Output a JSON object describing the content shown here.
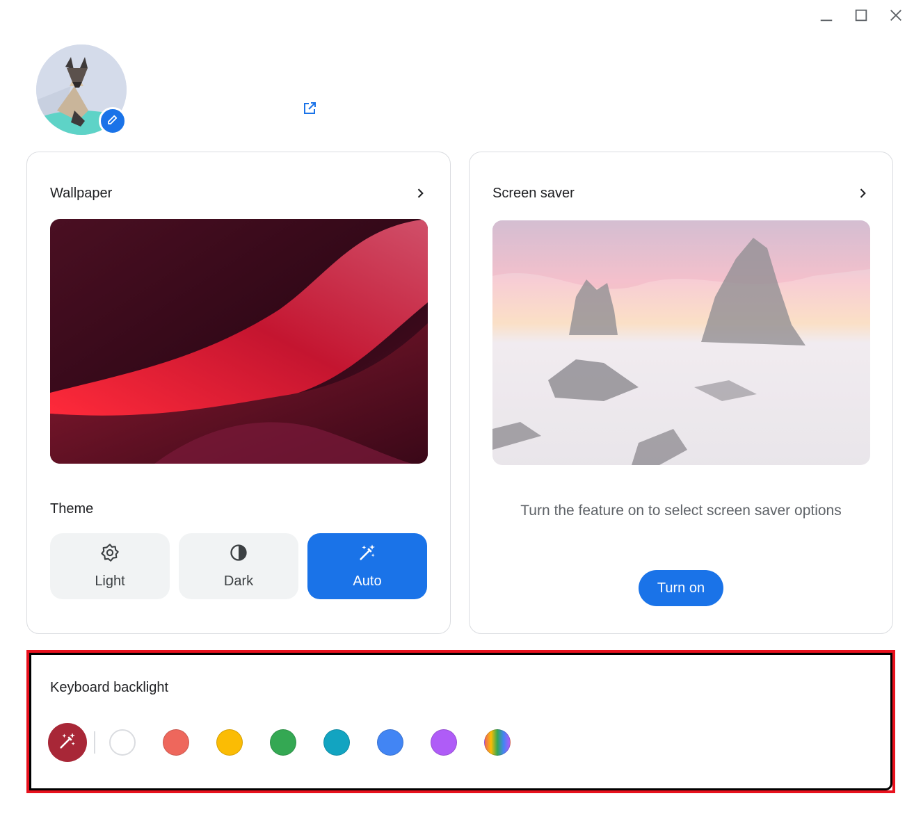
{
  "window_controls": {
    "minimize": "minimize-icon",
    "maximize": "maximize-icon",
    "close": "close-icon"
  },
  "profile": {
    "avatar": "origami-cat",
    "edit_icon": "pencil-icon",
    "external_link_icon": "open-in-new-icon"
  },
  "wallpaper": {
    "title": "Wallpaper"
  },
  "theme": {
    "label": "Theme",
    "options": [
      {
        "label": "Light",
        "icon": "brightness-icon",
        "selected": false
      },
      {
        "label": "Dark",
        "icon": "contrast-icon",
        "selected": false
      },
      {
        "label": "Auto",
        "icon": "magic-wand-icon",
        "selected": true
      }
    ]
  },
  "screen_saver": {
    "title": "Screen saver",
    "message": "Turn the feature on to select screen saver options",
    "button_label": "Turn on"
  },
  "keyboard_backlight": {
    "title": "Keyboard backlight",
    "selected": "auto",
    "auto_color": "#a82737",
    "colors": [
      {
        "name": "white",
        "hex": "#ffffff"
      },
      {
        "name": "red",
        "hex": "#ee675c"
      },
      {
        "name": "yellow",
        "hex": "#fbbc04"
      },
      {
        "name": "green",
        "hex": "#34a853"
      },
      {
        "name": "teal",
        "hex": "#12a4c1"
      },
      {
        "name": "blue",
        "hex": "#4285f4"
      },
      {
        "name": "purple",
        "hex": "#af5cf7"
      },
      {
        "name": "rainbow",
        "hex": "rainbow"
      }
    ]
  },
  "accent_color": "#1a73e8"
}
